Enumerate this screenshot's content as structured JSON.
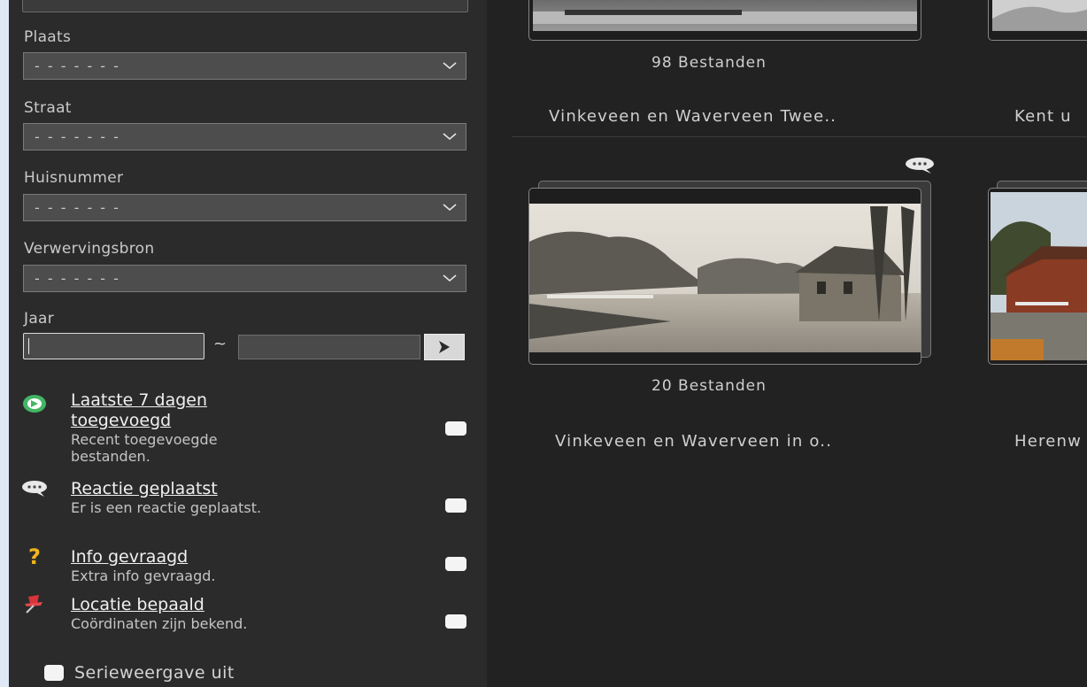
{
  "filters": {
    "plaats": {
      "label": "Plaats",
      "value": "- - - - - - -"
    },
    "straat": {
      "label": "Straat",
      "value": "- - - - - - -"
    },
    "huisnummer": {
      "label": "Huisnummer",
      "value": "- - - - - - -"
    },
    "verwervingsbron": {
      "label": "Verwervingsbron",
      "value": "- - - - - - -"
    },
    "jaar": {
      "label": "Jaar",
      "separator": "~",
      "from_value": "",
      "to_value": ""
    }
  },
  "quick_filters": [
    {
      "title": "Laatste 7 dagen toegevoegd",
      "description": "Recent toegevoegde bestanden.",
      "checked": false,
      "icon": "clock-arrow-icon"
    },
    {
      "title": "Reactie geplaatst",
      "description": "Er is een reactie geplaatst.",
      "checked": false,
      "icon": "speech-bubble-icon"
    },
    {
      "title": "Info gevraagd",
      "description": "Extra info gevraagd.",
      "checked": false,
      "icon": "question-mark-icon"
    },
    {
      "title": "Locatie bepaald",
      "description": "Coördinaten zijn bekend.",
      "checked": false,
      "icon": "pushpin-icon"
    }
  ],
  "serie": {
    "label": "Serieweergave uit",
    "checked": false
  },
  "results": [
    {
      "count": "98 Bestanden",
      "title": "Vinkeveen en Waverveen Twee.."
    },
    {
      "count": "",
      "title": "Kent u"
    },
    {
      "count": "20 Bestanden",
      "title": "Vinkeveen en Waverveen in o.."
    },
    {
      "count": "",
      "title": "Herenw"
    }
  ],
  "colors": {
    "sidebar_bg": "#2b2b2b",
    "main_bg": "#222222",
    "page_bg": "#dfe9f6",
    "accent_green": "#3cb15c",
    "accent_yellow": "#f2b51d",
    "accent_red": "#d8343a"
  }
}
